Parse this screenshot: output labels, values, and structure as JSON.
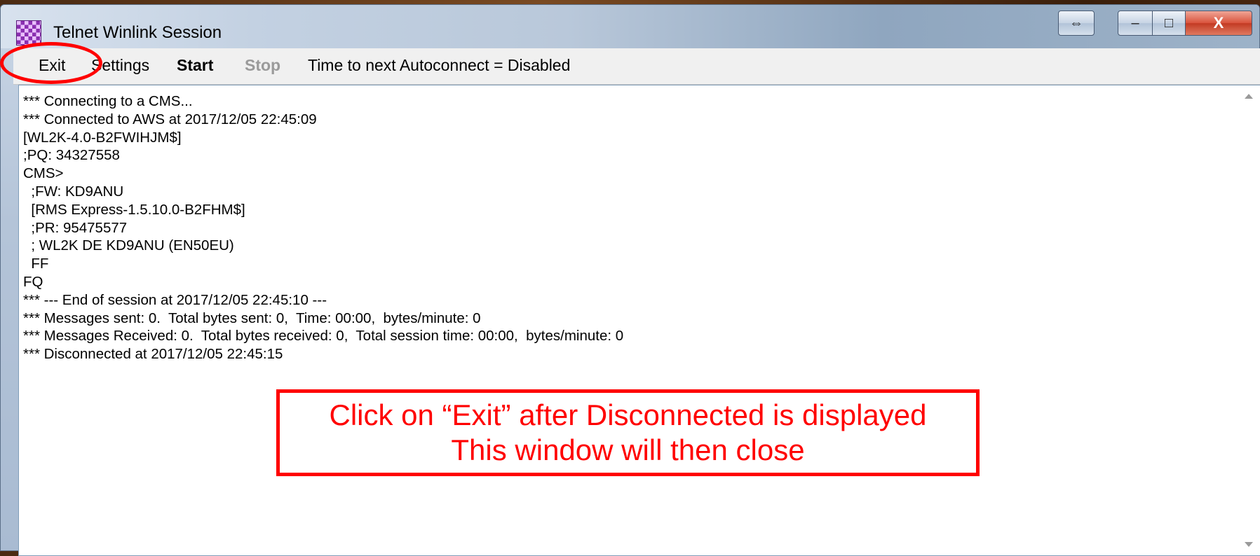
{
  "window": {
    "title": "Telnet Winlink Session",
    "app_icon": "winlink-checker-icon"
  },
  "titlebar_buttons": {
    "swap": "⇔",
    "minimize": "–",
    "maximize": "□",
    "close": "X"
  },
  "menu": {
    "exit": "Exit",
    "settings": "Settings",
    "start": "Start",
    "stop": "Stop",
    "status": "Time to next Autoconnect = Disabled"
  },
  "log": [
    "*** Connecting to a CMS...",
    "*** Connected to AWS at 2017/12/05 22:45:09",
    "[WL2K-4.0-B2FWIHJM$]",
    ";PQ: 34327558",
    "CMS>",
    "  ;FW: KD9ANU",
    "  [RMS Express-1.5.10.0-B2FHM$]",
    "  ;PR: 95475577",
    "  ; WL2K DE KD9ANU (EN50EU)",
    "  FF",
    "FQ",
    "*** --- End of session at 2017/12/05 22:45:10 ---",
    "*** Messages sent: 0.  Total bytes sent: 0,  Time: 00:00,  bytes/minute: 0",
    "*** Messages Received: 0.  Total bytes received: 0,  Total session time: 00:00,  bytes/minute: 0",
    "*** Disconnected at 2017/12/05 22:45:15"
  ],
  "callout": {
    "line1": "Click on “Exit” after Disconnected is displayed",
    "line2": "This window will then close"
  },
  "colors": {
    "annotation": "#ff0000",
    "stop_disabled": "#9a9a9a"
  }
}
